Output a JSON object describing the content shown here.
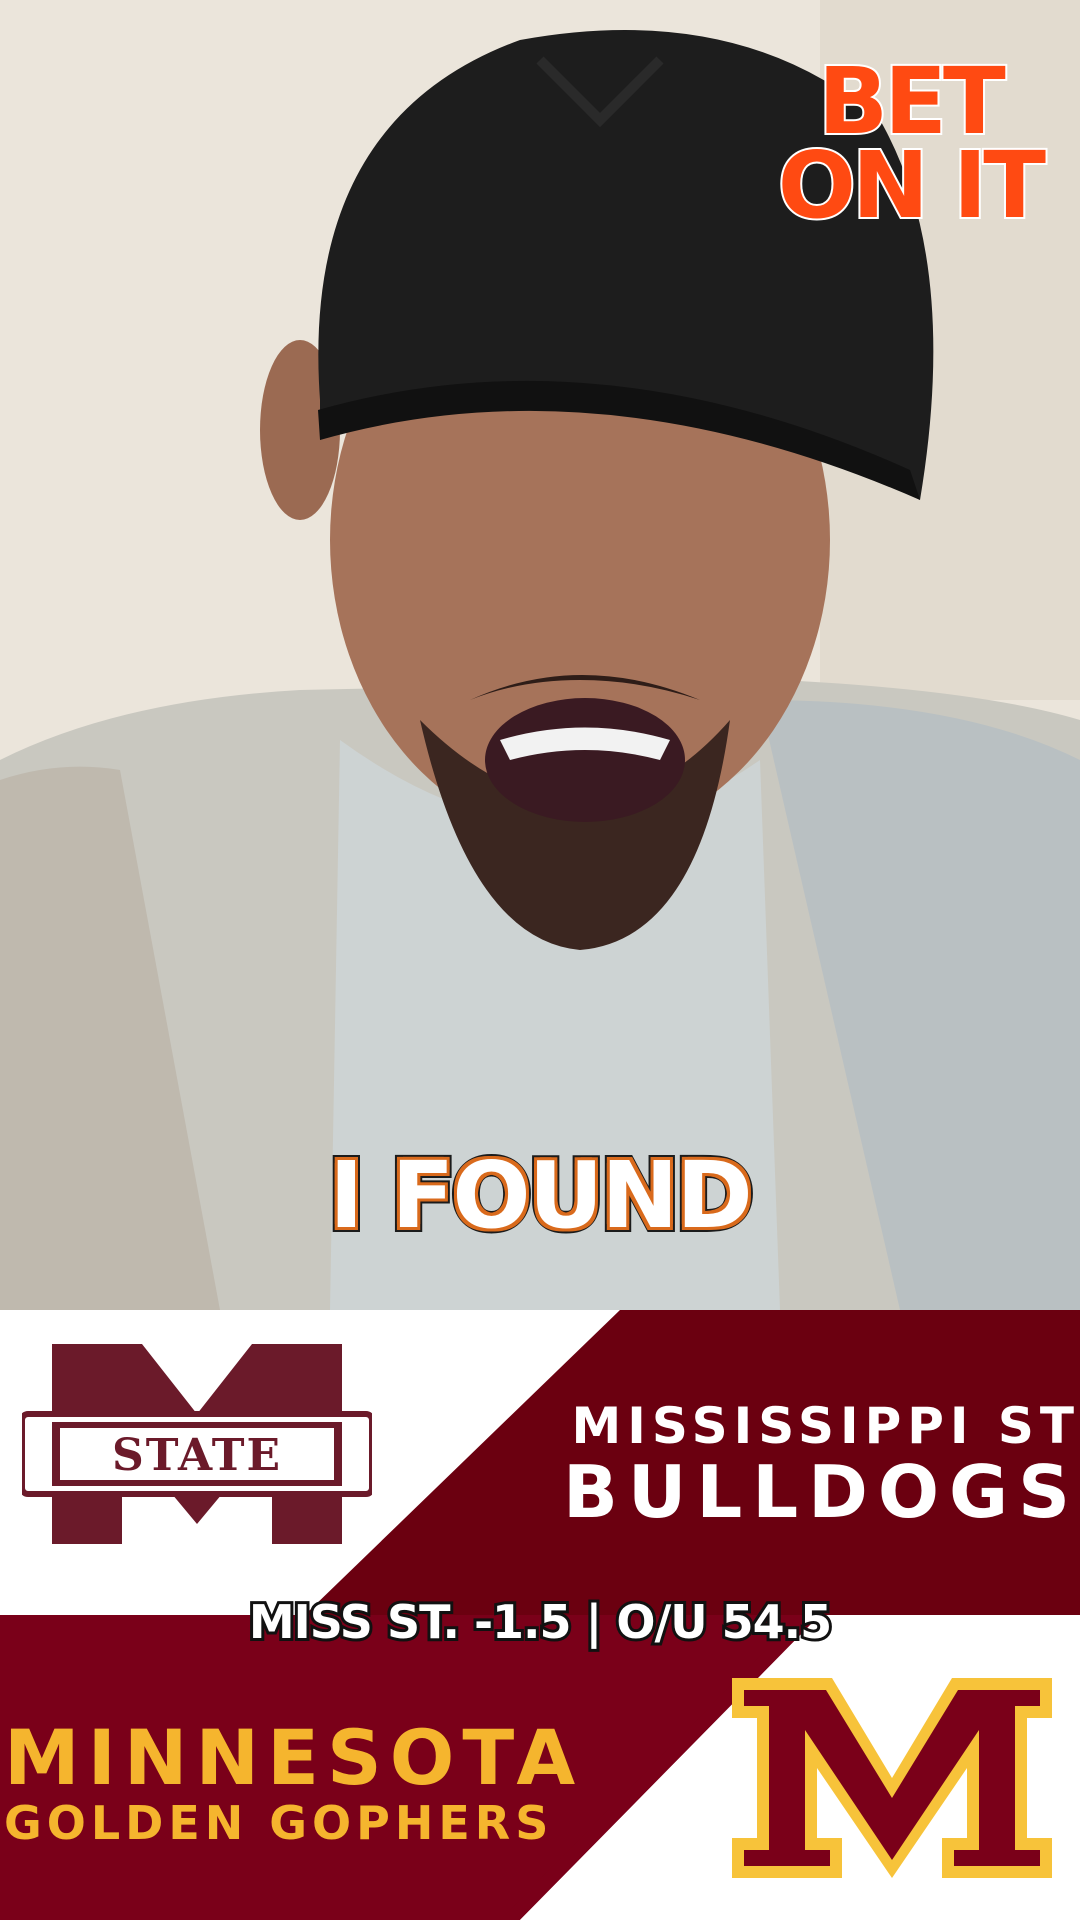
{
  "brand": {
    "line1": "BET",
    "line2": "ON IT"
  },
  "caption": "I FOUND",
  "matchup": {
    "team1": {
      "location": "MISSISSIPPI ST",
      "mascot": "BULLDOGS",
      "logo_text": "STATE",
      "color": "#660000"
    },
    "betting_line": "MISS ST. -1.5 | O/U 54.5",
    "team2": {
      "location": "MINNESOTA",
      "mascot": "GOLDEN GOPHERS",
      "color": "#7a0019",
      "accent": "#ffcc33"
    }
  },
  "colors": {
    "brand_orange": "#ff4a12",
    "caption_outline": "#d96a1c"
  }
}
